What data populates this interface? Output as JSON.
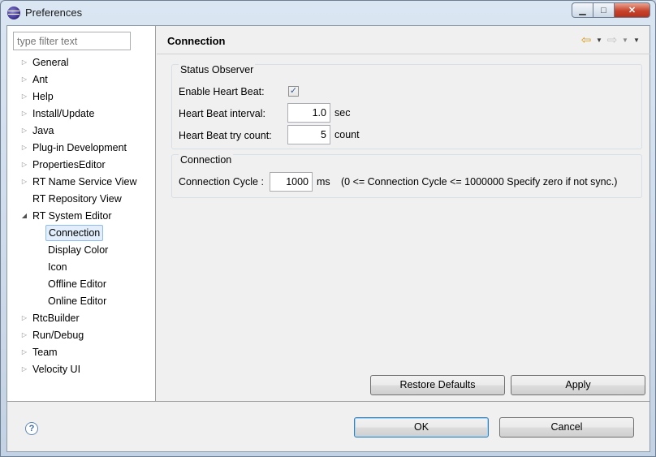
{
  "window": {
    "title": "Preferences",
    "close_glyph": "✕",
    "min_glyph": "▁",
    "max_glyph": "□"
  },
  "filter": {
    "placeholder": "type filter text"
  },
  "tree": {
    "items": [
      {
        "label": "General",
        "expandable": true
      },
      {
        "label": "Ant",
        "expandable": true
      },
      {
        "label": "Help",
        "expandable": true
      },
      {
        "label": "Install/Update",
        "expandable": true
      },
      {
        "label": "Java",
        "expandable": true
      },
      {
        "label": "Plug-in Development",
        "expandable": true
      },
      {
        "label": "PropertiesEditor",
        "expandable": true
      },
      {
        "label": "RT Name Service View",
        "expandable": true
      },
      {
        "label": "RT Repository View",
        "expandable": false
      },
      {
        "label": "RT System Editor",
        "expanded": true
      },
      {
        "label": "Connection",
        "child": true,
        "selected": true
      },
      {
        "label": "Display Color",
        "child": true
      },
      {
        "label": "Icon",
        "child": true
      },
      {
        "label": "Offline Editor",
        "child": true
      },
      {
        "label": "Online Editor",
        "child": true
      },
      {
        "label": "RtcBuilder",
        "expandable": true
      },
      {
        "label": "Run/Debug",
        "expandable": true
      },
      {
        "label": "Team",
        "expandable": true
      },
      {
        "label": "Velocity UI",
        "expandable": true
      }
    ]
  },
  "page": {
    "title": "Connection",
    "nav": {
      "back_glyph": "⇦",
      "forward_glyph": "⇨",
      "dropdown_glyph": "▼"
    }
  },
  "status_observer": {
    "title": "Status Observer",
    "enable_label": "Enable Heart Beat:",
    "enable_checked": true,
    "check_glyph": "✓",
    "interval_label": "Heart Beat interval:",
    "interval_value": "1.0",
    "interval_unit": "sec",
    "try_label": "Heart Beat try count:",
    "try_value": "5",
    "try_unit": "count"
  },
  "connection": {
    "title": "Connection",
    "cycle_label": "Connection Cycle :",
    "cycle_value": "1000",
    "cycle_unit": "ms",
    "cycle_note": "(0 <= Connection Cycle <= 1000000 Specify zero if not sync.)"
  },
  "buttons": {
    "restore_defaults": "Restore Defaults",
    "apply": "Apply",
    "ok": "OK",
    "cancel": "Cancel",
    "help_glyph": "?"
  }
}
